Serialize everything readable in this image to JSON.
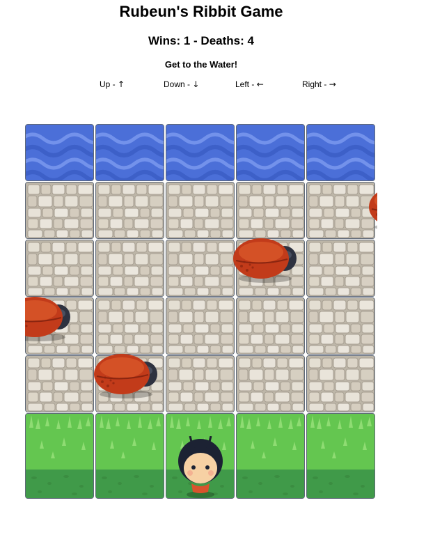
{
  "header": {
    "title": "Rubeun's Ribbit Game",
    "score_text": "Wins: 1 - Deaths: 4",
    "goal_text": "Get to the Water!"
  },
  "controls": [
    {
      "label": "Up - ",
      "arrow": "↑"
    },
    {
      "label": "Down - ",
      "arrow": "↓"
    },
    {
      "label": "Left - ",
      "arrow": "←"
    },
    {
      "label": "Right - ",
      "arrow": "→"
    }
  ],
  "board": {
    "columns": 5,
    "row_types": [
      "water",
      "stone",
      "stone",
      "stone",
      "stone",
      "grass"
    ],
    "enemies": [
      {
        "name": "red-beetle",
        "row": 1,
        "column": 5,
        "partially_visible": true
      },
      {
        "name": "red-beetle",
        "row": 2,
        "column": 4
      },
      {
        "name": "red-beetle",
        "row": 3,
        "column": 1,
        "partially_visible": true
      },
      {
        "name": "red-beetle",
        "row": 4,
        "column": 2
      }
    ],
    "player": {
      "name": "boy-character",
      "row": 5,
      "column": 3
    }
  },
  "colors": {
    "water": "#4a6fd6",
    "stone": "#d9d3c5",
    "grass": "#5fbf4c",
    "dirt": "#3f9a4a",
    "beetle": "#c0391b"
  }
}
